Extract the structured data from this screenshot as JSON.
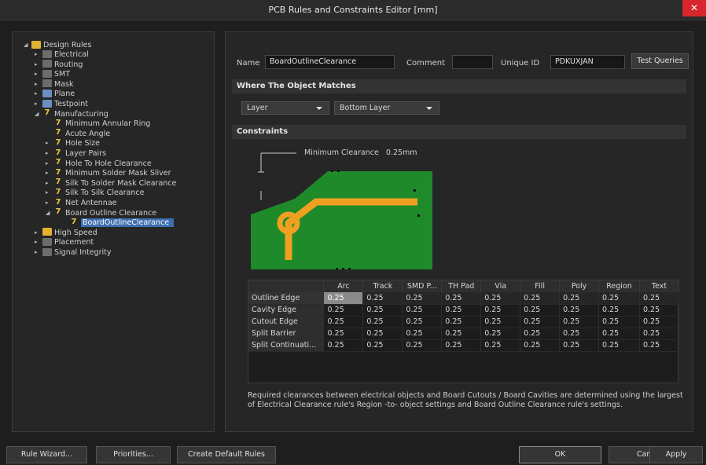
{
  "window": {
    "title": "PCB Rules and Constraints Editor [mm]",
    "close_glyph": "✕"
  },
  "tree": {
    "root": "Design Rules",
    "top_items": [
      "Electrical",
      "Routing",
      "SMT",
      "Mask",
      "Plane",
      "Testpoint",
      "Manufacturing"
    ],
    "manufacturing_children": [
      "Minimum Annular Ring",
      "Acute Angle",
      "Hole Size",
      "Layer Pairs",
      "Hole To Hole Clearance",
      "Minimum Solder Mask Sliver",
      "Silk To Solder Mask Clearance",
      "Silk To Silk Clearance",
      "Net Antennae",
      "Board Outline Clearance"
    ],
    "selected_rule": "BoardOutlineClearance",
    "bottom_items": [
      "High Speed",
      "Placement",
      "Signal Integrity"
    ]
  },
  "rule": {
    "name_label": "Name",
    "name_value": "BoardOutlineClearance",
    "comment_label": "Comment",
    "comment_value": "",
    "uid_label": "Unique ID",
    "uid_value": "PDKUXJAN",
    "test_queries": "Test Queries"
  },
  "where": {
    "header": "Where The Object Matches",
    "scope_value": "Layer",
    "layer_value": "Bottom Layer"
  },
  "constraints": {
    "header": "Constraints",
    "min_clearance_label": "Minimum Clearance",
    "min_clearance_value": "0.25mm"
  },
  "grid": {
    "columns": [
      "",
      "Arc",
      "Track",
      "SMD P...",
      "TH Pad",
      "Via",
      "Fill",
      "Poly",
      "Region",
      "Text"
    ],
    "rows": [
      {
        "name": "Outline Edge",
        "values": [
          "0.25",
          "0.25",
          "0.25",
          "0.25",
          "0.25",
          "0.25",
          "0.25",
          "0.25",
          "0.25"
        ]
      },
      {
        "name": "Cavity Edge",
        "values": [
          "0.25",
          "0.25",
          "0.25",
          "0.25",
          "0.25",
          "0.25",
          "0.25",
          "0.25",
          "0.25"
        ]
      },
      {
        "name": "Cutout Edge",
        "values": [
          "0.25",
          "0.25",
          "0.25",
          "0.25",
          "0.25",
          "0.25",
          "0.25",
          "0.25",
          "0.25"
        ]
      },
      {
        "name": "Split Barrier",
        "values": [
          "0.25",
          "0.25",
          "0.25",
          "0.25",
          "0.25",
          "0.25",
          "0.25",
          "0.25",
          "0.25"
        ]
      },
      {
        "name": "Split Continuati...",
        "values": [
          "0.25",
          "0.25",
          "0.25",
          "0.25",
          "0.25",
          "0.25",
          "0.25",
          "0.25",
          "0.25"
        ]
      }
    ]
  },
  "description": "Required clearances between electrical objects and Board Cutouts / Board Cavities are determined using the largest of Electrical Clearance rule's Region -to- object settings and Board Outline Clearance rule's settings.",
  "buttons": {
    "rule_wizard": "Rule Wizard...",
    "priorities": "Priorities...",
    "create_default": "Create Default Rules",
    "ok": "OK",
    "cancel": "Cancel",
    "apply": "Apply"
  },
  "colors": {
    "board": "#1e8a2a",
    "trace": "#f0a020",
    "selection": "#3d6fb0",
    "close": "#d8262e"
  }
}
